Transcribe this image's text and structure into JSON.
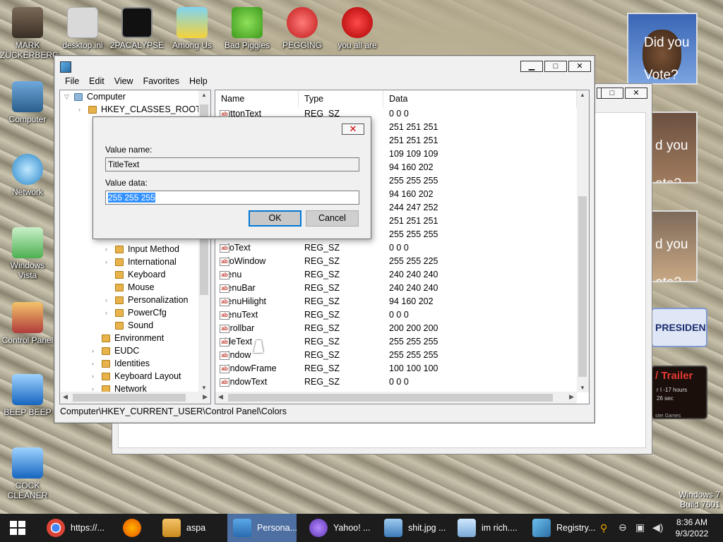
{
  "desktop_icons": [
    {
      "label": "MARK ZUCKERBERG",
      "icon": "folder-avatar-icon"
    },
    {
      "label": "desktop.ini",
      "icon": "settings-file-icon"
    },
    {
      "label": "2PACALYPSE",
      "icon": "console-icon"
    },
    {
      "label": "Among Us",
      "icon": "warning-folder-icon"
    },
    {
      "label": "Bad Piggies",
      "icon": "green-pig-icon"
    },
    {
      "label": "PEGGING",
      "icon": "letter-p-icon"
    },
    {
      "label": "you all are",
      "icon": "devcpp-icon"
    },
    {
      "label": "Computer",
      "icon": "computer-icon"
    },
    {
      "label": "Network",
      "icon": "globe-icon"
    },
    {
      "label": "Windows Vista",
      "icon": "recycle-bin-icon"
    },
    {
      "label": "Control Panel",
      "icon": "control-panel-icon"
    },
    {
      "label": "BEEP BEEP",
      "icon": "blue-bar-icon"
    },
    {
      "label": "COCK CLEANER",
      "icon": "blue-bar-icon"
    }
  ],
  "side_ads": {
    "obama_text": "Did you Vote?",
    "ad2_text": "d you ote?",
    "ad3_text": "d you ote?",
    "president": "PRESIDENT",
    "trailer": "/ Trailer",
    "trailer_sub1": "r I -17 hours",
    "trailer_sub2": "26 sec",
    "trailer_sub3": "ster Games"
  },
  "watermark": {
    "line1": "Windows 7",
    "line2": "Build 7601"
  },
  "regedit": {
    "menu": [
      "File",
      "Edit",
      "View",
      "Favorites",
      "Help"
    ],
    "tree": [
      {
        "label": "Computer",
        "level": 0
      },
      {
        "label": "HKEY_CLASSES_ROOT",
        "level": 1
      },
      {
        "label": "Input Method",
        "level": 3
      },
      {
        "label": "International",
        "level": 3
      },
      {
        "label": "Keyboard",
        "level": 3
      },
      {
        "label": "Mouse",
        "level": 3
      },
      {
        "label": "Personalization",
        "level": 3
      },
      {
        "label": "PowerCfg",
        "level": 3
      },
      {
        "label": "Sound",
        "level": 3
      },
      {
        "label": "Environment",
        "level": 2
      },
      {
        "label": "EUDC",
        "level": 2
      },
      {
        "label": "Identities",
        "level": 2
      },
      {
        "label": "Keyboard Layout",
        "level": 2
      },
      {
        "label": "Network",
        "level": 2
      }
    ],
    "columns": {
      "name": "Name",
      "type": "Type",
      "data": "Data"
    },
    "rows": [
      {
        "name": "ButtonText",
        "type": "REG_SZ",
        "data": "0 0 0"
      },
      {
        "name": "",
        "type": "",
        "data": "251 251 251"
      },
      {
        "name": "",
        "type": "",
        "data": "251 251 251"
      },
      {
        "name": "",
        "type": "",
        "data": "109 109 109"
      },
      {
        "name": "",
        "type": "",
        "data": "94 160 202"
      },
      {
        "name": "",
        "type": "",
        "data": "255 255 255"
      },
      {
        "name": "",
        "type": "",
        "data": "94 160 202"
      },
      {
        "name": "",
        "type": "",
        "data": "244 247 252"
      },
      {
        "name": "",
        "type": "",
        "data": "251 251 251"
      },
      {
        "name": "",
        "type": "",
        "data": "255 255 255"
      },
      {
        "name": "InfoText",
        "type": "REG_SZ",
        "data": "0 0 0"
      },
      {
        "name": "InfoWindow",
        "type": "REG_SZ",
        "data": "255 255 225"
      },
      {
        "name": "Menu",
        "type": "REG_SZ",
        "data": "240 240 240"
      },
      {
        "name": "MenuBar",
        "type": "REG_SZ",
        "data": "240 240 240"
      },
      {
        "name": "MenuHilight",
        "type": "REG_SZ",
        "data": "94 160 202"
      },
      {
        "name": "MenuText",
        "type": "REG_SZ",
        "data": "0 0 0"
      },
      {
        "name": "Scrollbar",
        "type": "REG_SZ",
        "data": "200 200 200"
      },
      {
        "name": "TitleText",
        "type": "REG_SZ",
        "data": "255 255 255"
      },
      {
        "name": "Window",
        "type": "REG_SZ",
        "data": "255 255 255"
      },
      {
        "name": "WindowFrame",
        "type": "REG_SZ",
        "data": "100 100 100"
      },
      {
        "name": "WindowText",
        "type": "REG_SZ",
        "data": "0 0 0"
      }
    ],
    "status_path": "Computer\\HKEY_CURRENT_USER\\Control Panel\\Colors"
  },
  "dialog": {
    "value_name_label": "Value name:",
    "value_name": "TitleText",
    "value_data_label": "Value data:",
    "value_data": "255 255 255",
    "ok": "OK",
    "cancel": "Cancel",
    "close_glyph": "✕"
  },
  "window_buttons": {
    "minimize": "▁",
    "maximize": "□",
    "close": "✕"
  },
  "taskbar": {
    "items": [
      {
        "label": "https://...",
        "icon": "chrome-icon",
        "active": false
      },
      {
        "label": "",
        "icon": "firefox-icon",
        "active": false
      },
      {
        "label": "aspa",
        "icon": "folder-icon",
        "active": false
      },
      {
        "label": "Persona...",
        "icon": "personalization-icon",
        "active": true
      },
      {
        "label": "Yahoo! ...",
        "icon": "yahoo-icon",
        "active": false
      },
      {
        "label": "shit.jpg ...",
        "icon": "image-viewer-icon",
        "active": false
      },
      {
        "label": "im rich....",
        "icon": "notepad-icon",
        "active": false
      },
      {
        "label": "Registry...",
        "icon": "registry-icon",
        "active": false
      }
    ],
    "time": "8:36 AM",
    "date": "9/3/2022"
  }
}
